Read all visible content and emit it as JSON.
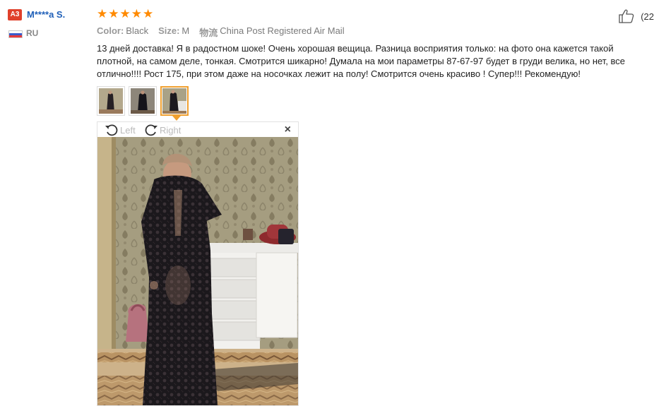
{
  "reviewer": {
    "level": "A3",
    "name": "M****a S.",
    "country": "RU"
  },
  "review": {
    "rating": 5,
    "stars": [
      "★",
      "★",
      "★",
      "★",
      "★"
    ],
    "meta": {
      "color_label": "Color:",
      "color_value": "Black",
      "size_label": "Size:",
      "size_value": "M",
      "shipping_label": "物流",
      "shipping_value": "China Post Registered Air Mail"
    },
    "text_lines": [
      "13 дней доставка! Я в радостном шоке! Очень хорошая вещица. Разница восприятия только: на фото она кажется такой",
      "плотной, на самом деле, тонкая. Смотрится шикарно! Думала на мои параметры 87-67-97 будет в груди велика, но нет, все",
      "отлично!!!! Рост 175, при этом даже на носочках лежит на полу! Смотрится очень красиво ! Супер!!! Рекомендую!"
    ],
    "helpful_count": "(22",
    "thumbnails": [
      {
        "name": "photo-1",
        "active": false
      },
      {
        "name": "photo-2",
        "active": false
      },
      {
        "name": "photo-3",
        "active": true
      }
    ]
  },
  "viewer": {
    "rotate_left_label": "Left",
    "rotate_right_label": "Right",
    "close_glyph": "×"
  },
  "icons": {
    "thumbs_up": "thumbs-up-icon",
    "rotate_left": "rotate-left-icon",
    "rotate_right": "rotate-right-icon",
    "close": "close-icon",
    "flag": "russia-flag-icon"
  },
  "colors": {
    "level_badge": "#e0402b",
    "name": "#1f5fb8",
    "star": "#ff8a00",
    "active_thumb": "#f0a030"
  }
}
